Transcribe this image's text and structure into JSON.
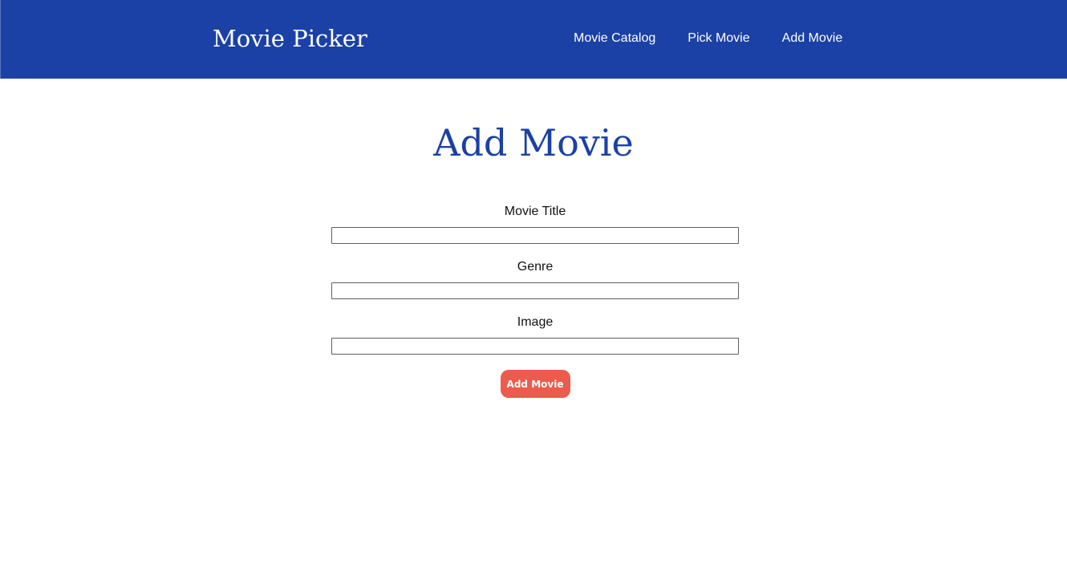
{
  "header": {
    "brand": "Movie Picker",
    "nav": [
      {
        "label": "Movie Catalog"
      },
      {
        "label": "Pick Movie"
      },
      {
        "label": "Add Movie"
      }
    ]
  },
  "main": {
    "title": "Add Movie",
    "fields": [
      {
        "label": "Movie Title",
        "value": ""
      },
      {
        "label": "Genre",
        "value": ""
      },
      {
        "label": "Image",
        "value": ""
      }
    ],
    "submit_label": "Add Movie"
  },
  "colors": {
    "brand_blue": "#1b41a6",
    "accent_red": "#eb5c4e",
    "background": "#ffffff"
  }
}
